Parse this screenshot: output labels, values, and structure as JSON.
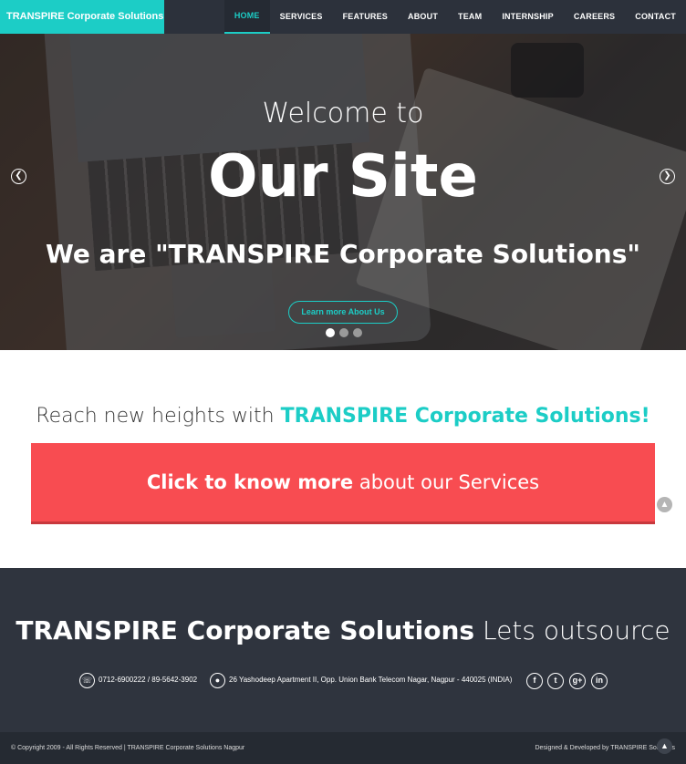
{
  "colors": {
    "accent": "#1ccdc6",
    "cta": "#f84c51",
    "footer": "#2f343e",
    "navbar": "#2c313b"
  },
  "navbar": {
    "brand": "TRANSPIRE Corporate Solutions",
    "links": [
      "HOME",
      "SERVICES",
      "FEATURES",
      "ABOUT",
      "TEAM",
      "INTERNSHIP",
      "CAREERS",
      "CONTACT"
    ],
    "active": "HOME"
  },
  "hero": {
    "welcome": "Welcome to",
    "title": "Our Site",
    "tagline": "We are \"TRANSPIRE Corporate Solutions\"",
    "button": "Learn more About Us",
    "prev_icon": "chevron-left-icon",
    "next_icon": "chevron-right-icon",
    "slides": 3,
    "active_slide": 1
  },
  "reach": {
    "prefix": "Reach new heights with",
    "accent": "TRANSPIRE Corporate Solutions!"
  },
  "cta": {
    "strong": "Click to know more",
    "rest": "about our Services"
  },
  "footer": {
    "title_strong": "TRANSPIRE Corporate Solutions",
    "title_light": "Lets outsource",
    "phone": "0712-6900222 / 89-5642-3902",
    "address": "26 Yashodeep Apartment II, Opp. Union Bank Telecom Nagar, Nagpur - 440025 (INDIA)",
    "phone_icon": "phone-icon",
    "location_icon": "location-icon",
    "social": [
      "facebook-icon",
      "twitter-icon",
      "google-plus-icon",
      "linkedin-icon"
    ],
    "copyright": "© Copyright 2009 - All Rights Reserved | TRANSPIRE Corporate Solutions Nagpur",
    "designed": "Designed & Developed by TRANSPIRE Solutions"
  }
}
